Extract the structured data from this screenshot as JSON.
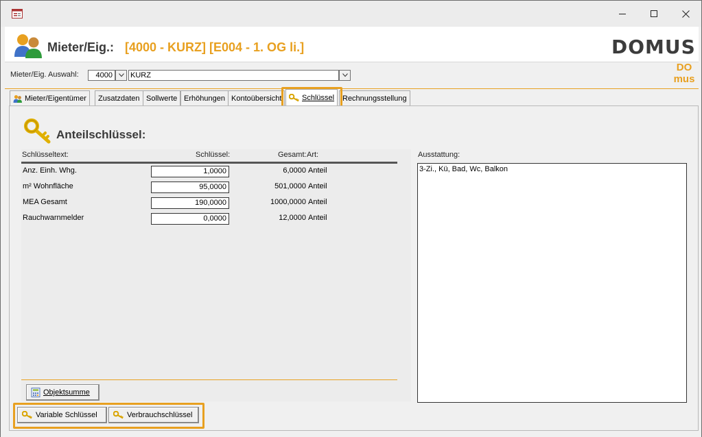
{
  "header": {
    "label": "Mieter/Eig.:",
    "record": "[4000 - KURZ] [E004 - 1. OG li.]",
    "logo_big": "DOMUS",
    "logo_small_top": "DO",
    "logo_small_bottom": "mus"
  },
  "selection": {
    "label": "Mieter/Eig. Auswahl:",
    "number": "4000",
    "name": "KURZ"
  },
  "tabs": [
    {
      "label": "Mieter/Eigentümer"
    },
    {
      "label": "Zusatzdaten"
    },
    {
      "label": "Sollwerte"
    },
    {
      "label": "Erhöhungen"
    },
    {
      "label": "Kontoübersicht"
    },
    {
      "label": "Schlüssel"
    },
    {
      "label": "Rechnungsstellung"
    }
  ],
  "section": {
    "title": "Anteilschlüssel:"
  },
  "grid": {
    "headers": {
      "text": "Schlüsseltext:",
      "key": "Schlüssel:",
      "total": "Gesamt:",
      "art": "Art:"
    },
    "rows": [
      {
        "text": "Anz. Einh. Whg.",
        "value": "1,0000",
        "total": "6,0000",
        "art": "Anteil"
      },
      {
        "text": "m² Wohnfläche",
        "value": "95,0000",
        "total": "501,0000",
        "art": "Anteil"
      },
      {
        "text": "MEA Gesamt",
        "value": "190,0000",
        "total": "1000,0000",
        "art": "Anteil"
      },
      {
        "text": "Rauchwarnmelder",
        "value": "0,0000",
        "total": "12,0000",
        "art": "Anteil"
      }
    ]
  },
  "buttons": {
    "objektsumme": "Objektsumme",
    "variable": "Variable Schlüssel",
    "verbrauch": "Verbrauchschlüssel"
  },
  "ausstattung": {
    "label": "Ausstattung:",
    "value": "3-Zi., Kü, Bad, Wc, Balkon"
  },
  "colors": {
    "accent": "#e8a020",
    "header_text": "#3a3a3a"
  }
}
